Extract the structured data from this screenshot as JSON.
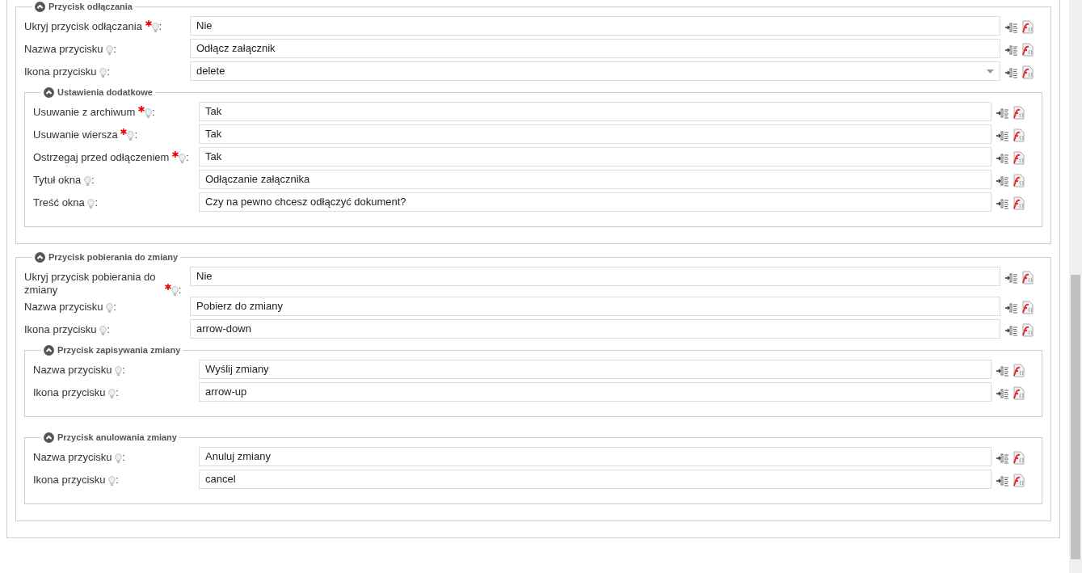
{
  "sections": [
    {
      "title": "Przycisk odłączania",
      "expanded": true,
      "fields": [
        {
          "label": "Ukryj przycisk odłączania",
          "required": true,
          "suffix": ":",
          "kind": "text",
          "value": "Nie"
        },
        {
          "label": "Nazwa przycisku",
          "required": false,
          "suffix": ":",
          "kind": "text",
          "value": "Odłącz załącznik"
        },
        {
          "label": "Ikona przycisku",
          "required": false,
          "suffix": ":",
          "kind": "select",
          "value": "delete"
        }
      ],
      "sections": [
        {
          "title": "Ustawienia dodatkowe",
          "expanded": true,
          "fields": [
            {
              "label": "Usuwanie z archiwum",
              "required": true,
              "suffix": ":",
              "kind": "text",
              "value": "Tak"
            },
            {
              "label": "Usuwanie wiersza",
              "required": true,
              "suffix": ":",
              "kind": "text",
              "value": "Tak"
            },
            {
              "label": "Ostrzegaj przed odłączeniem",
              "required": true,
              "suffix": ":",
              "kind": "text",
              "value": "Tak"
            },
            {
              "label": "Tytuł okna",
              "required": false,
              "suffix": ":",
              "kind": "text",
              "value": "Odłączanie załącznika"
            },
            {
              "label": "Treść okna",
              "required": false,
              "suffix": ":",
              "kind": "text",
              "value": "Czy na pewno chcesz odłączyć dokument?"
            }
          ]
        }
      ]
    },
    {
      "title": "Przycisk pobierania do zmiany",
      "expanded": true,
      "fields": [
        {
          "label": "Ukryj przycisk pobierania do zmiany",
          "required": true,
          "suffix": ":",
          "kind": "text",
          "value": "Nie"
        },
        {
          "label": "Nazwa przycisku",
          "required": false,
          "suffix": ":",
          "kind": "text",
          "value": "Pobierz do zmiany"
        },
        {
          "label": "Ikona przycisku",
          "required": false,
          "suffix": ":",
          "kind": "text",
          "value": "arrow-down"
        }
      ],
      "sections": [
        {
          "title": "Przycisk zapisywania zmiany",
          "expanded": true,
          "fields": [
            {
              "label": "Nazwa przycisku",
              "required": false,
              "suffix": ":",
              "kind": "text",
              "value": "Wyślij zmiany"
            },
            {
              "label": "Ikona przycisku",
              "required": false,
              "suffix": ":",
              "kind": "text",
              "value": "arrow-up"
            }
          ]
        },
        {
          "title": "Przycisk anulowania zmiany",
          "expanded": true,
          "fields": [
            {
              "label": "Nazwa przycisku",
              "required": false,
              "suffix": ":",
              "kind": "text",
              "value": "Anuluj zmiany"
            },
            {
              "label": "Ikona przycisku",
              "required": false,
              "suffix": ":",
              "kind": "text",
              "value": "cancel"
            }
          ]
        }
      ]
    }
  ]
}
